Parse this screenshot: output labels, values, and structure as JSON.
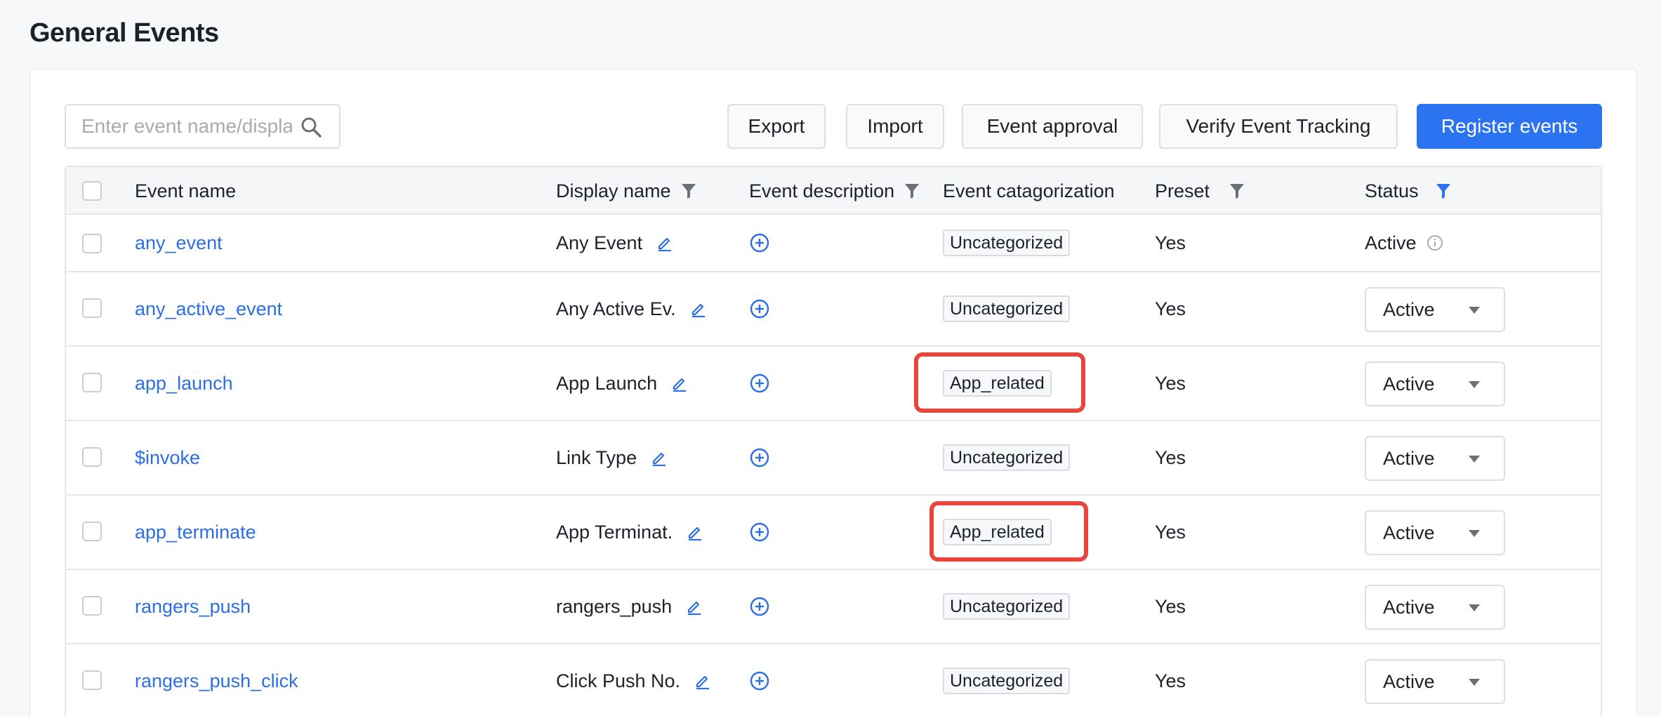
{
  "page": {
    "title": "General Events"
  },
  "search": {
    "placeholder": "Enter event name/display name"
  },
  "toolbar": {
    "export_label": "Export",
    "import_label": "Import",
    "event_approval_label": "Event approval",
    "verify_label": "Verify Event Tracking",
    "register_label": "Register events"
  },
  "table": {
    "columns": {
      "event_name": "Event name",
      "display_name": "Display name",
      "event_description": "Event description",
      "event_categorization": "Event catagorization",
      "preset": "Preset",
      "status": "Status"
    },
    "rows": [
      {
        "event_name": "any_event",
        "display_name": "Any Event",
        "category": "Uncategorized",
        "preset": "Yes",
        "status": "Active",
        "status_type": "text"
      },
      {
        "event_name": "any_active_event",
        "display_name": "Any Active Ev.",
        "category": "Uncategorized",
        "preset": "Yes",
        "status": "Active",
        "status_type": "select"
      },
      {
        "event_name": "app_launch",
        "display_name": "App Launch",
        "category": "App_related",
        "preset": "Yes",
        "status": "Active",
        "status_type": "select",
        "highlighted": true
      },
      {
        "event_name": "$invoke",
        "display_name": "Link Type",
        "category": "Uncategorized",
        "preset": "Yes",
        "status": "Active",
        "status_type": "select"
      },
      {
        "event_name": "app_terminate",
        "display_name": "App Terminat.",
        "category": "App_related",
        "preset": "Yes",
        "status": "Active",
        "status_type": "select",
        "highlighted": true
      },
      {
        "event_name": "rangers_push",
        "display_name": "rangers_push",
        "category": "Uncategorized",
        "preset": "Yes",
        "status": "Active",
        "status_type": "select"
      },
      {
        "event_name": "rangers_push_click",
        "display_name": "Click Push No.",
        "category": "Uncategorized",
        "preset": "Yes",
        "status": "Active",
        "status_type": "select"
      }
    ]
  },
  "icons": {
    "search": "search-icon",
    "filter": "filter-icon",
    "edit": "edit-icon",
    "add_description": "plus-circle-icon",
    "info": "info-icon",
    "dropdown": "chevron-down-icon"
  },
  "colors": {
    "accent": "#2b73f0",
    "link": "#2b6fe8",
    "highlight": "#e8453c",
    "active_filter": "#2b73f0",
    "inactive_filter": "#6b6f76"
  }
}
